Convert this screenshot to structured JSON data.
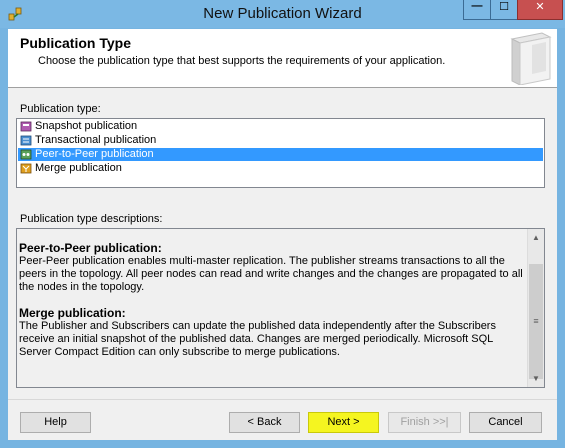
{
  "window": {
    "title": "New Publication Wizard",
    "minimize_glyph": "—",
    "maximize_glyph": "☐",
    "close_glyph": "✕"
  },
  "header": {
    "title": "Publication Type",
    "subtitle": "Choose the publication type that best supports the requirements of your application."
  },
  "publication_types": {
    "label": "Publication type:",
    "items": [
      {
        "label": "Snapshot publication",
        "icon": "snapshot-publication-icon",
        "color": "#b05bb0"
      },
      {
        "label": "Transactional publication",
        "icon": "transactional-publication-icon",
        "color": "#4a8fd0"
      },
      {
        "label": "Peer-to-Peer publication",
        "icon": "peer-to-peer-publication-icon",
        "color": "#5aa15a"
      },
      {
        "label": "Merge publication",
        "icon": "merge-publication-icon",
        "color": "#e0a020"
      }
    ],
    "selected_index": 2
  },
  "descriptions": {
    "label": "Publication type descriptions:",
    "entries": [
      {
        "heading": "Peer-to-Peer publication:",
        "text": "Peer-Peer publication enables multi-master replication. The publisher streams transactions to all the peers in the topology. All peer nodes can read and write changes and the changes are propagated to all the nodes in the topology."
      },
      {
        "heading": "Merge publication:",
        "text": "The Publisher and Subscribers can update the published data independently after the Subscribers receive an initial snapshot of the published data. Changes are merged periodically. Microsoft SQL Server Compact Edition can only subscribe to merge publications."
      }
    ]
  },
  "buttons": {
    "help": "Help",
    "back": "< Back",
    "next": "Next >",
    "finish": "Finish >>|",
    "cancel": "Cancel"
  },
  "colors": {
    "title_bar": "#7bb8e4",
    "selection": "#3399ff",
    "next_highlight": "#f5f520"
  }
}
